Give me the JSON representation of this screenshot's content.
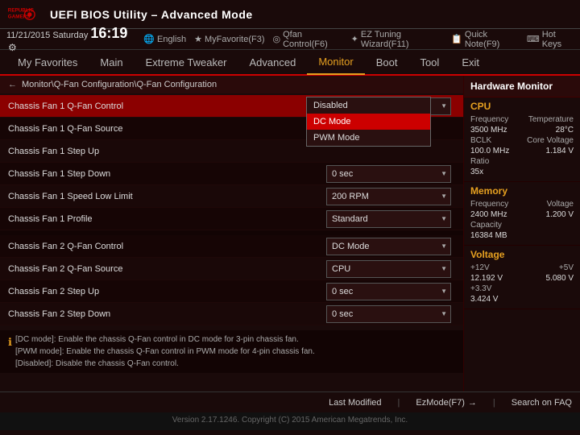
{
  "header": {
    "brand_line1": "REPUBLIC OF",
    "brand_line2": "GAMERS",
    "title": "UEFI BIOS Utility – Advanced Mode"
  },
  "toolbar": {
    "date": "11/21/2015",
    "day": "Saturday",
    "time": "16:19",
    "gear_icon": "⚙",
    "language": "English",
    "myfavorites": "MyFavorite(F3)",
    "qfan": "Qfan Control(F6)",
    "eztuning": "EZ Tuning Wizard(F11)",
    "quicknote": "Quick Note(F9)",
    "hotkeys": "Hot Keys"
  },
  "nav": {
    "items": [
      {
        "label": "My Favorites",
        "active": false
      },
      {
        "label": "Main",
        "active": false
      },
      {
        "label": "Extreme Tweaker",
        "active": false
      },
      {
        "label": "Advanced",
        "active": false
      },
      {
        "label": "Monitor",
        "active": true
      },
      {
        "label": "Boot",
        "active": false
      },
      {
        "label": "Tool",
        "active": false
      },
      {
        "label": "Exit",
        "active": false
      }
    ]
  },
  "breadcrumb": "Monitor\\Q-Fan Configuration\\Q-Fan Configuration",
  "settings": [
    {
      "label": "Chassis Fan 1 Q-Fan Control",
      "value": "DC Mode",
      "active": true,
      "type": "dropdown"
    },
    {
      "label": "Chassis Fan 1 Q-Fan Source",
      "value": "",
      "active": false,
      "type": "empty"
    },
    {
      "label": "Chassis Fan 1 Step Up",
      "value": "",
      "active": false,
      "type": "empty"
    },
    {
      "label": "Chassis Fan 1 Step Down",
      "value": "0 sec",
      "active": false,
      "type": "dropdown"
    },
    {
      "label": "Chassis Fan 1 Speed Low Limit",
      "value": "200 RPM",
      "active": false,
      "type": "dropdown"
    },
    {
      "label": "Chassis Fan 1 Profile",
      "value": "Standard",
      "active": false,
      "type": "dropdown"
    },
    {
      "label": "Chassis Fan 2 Q-Fan Control",
      "value": "DC Mode",
      "active": false,
      "type": "dropdown"
    },
    {
      "label": "Chassis Fan 2 Q-Fan Source",
      "value": "CPU",
      "active": false,
      "type": "dropdown"
    },
    {
      "label": "Chassis Fan 2 Step Up",
      "value": "0 sec",
      "active": false,
      "type": "dropdown"
    },
    {
      "label": "Chassis Fan 2 Step Down",
      "value": "0 sec",
      "active": false,
      "type": "dropdown"
    }
  ],
  "dropdown_popup": {
    "items": [
      {
        "label": "Disabled",
        "selected": false
      },
      {
        "label": "DC Mode",
        "selected": true
      },
      {
        "label": "PWM Mode",
        "selected": false
      }
    ]
  },
  "info_lines": [
    "[DC mode]: Enable the chassis Q-Fan control in DC mode for 3-pin chassis fan.",
    "[PWM mode]: Enable the chassis Q-Fan control in PWM mode for 4-pin chassis fan.",
    "[Disabled]: Disable the chassis Q-Fan control."
  ],
  "hw_monitor": {
    "title": "Hardware Monitor",
    "cpu": {
      "section_title": "CPU",
      "frequency_label": "Frequency",
      "frequency_value": "3500 MHz",
      "temperature_label": "Temperature",
      "temperature_value": "28°C",
      "bclk_label": "BCLK",
      "bclk_value": "100.0 MHz",
      "core_voltage_label": "Core Voltage",
      "core_voltage_value": "1.184 V",
      "ratio_label": "Ratio",
      "ratio_value": "35x"
    },
    "memory": {
      "section_title": "Memory",
      "frequency_label": "Frequency",
      "frequency_value": "2400 MHz",
      "voltage_label": "Voltage",
      "voltage_value": "1.200 V",
      "capacity_label": "Capacity",
      "capacity_value": "16384 MB"
    },
    "voltage": {
      "section_title": "Voltage",
      "v12_label": "+12V",
      "v12_value": "12.192 V",
      "v5_label": "+5V",
      "v5_value": "5.080 V",
      "v33_label": "+3.3V",
      "v33_value": "3.424 V"
    }
  },
  "status_bar": {
    "last_modified": "Last Modified",
    "ez_mode": "EzMode(F7)",
    "ez_icon": "→",
    "search": "Search on FAQ"
  },
  "footer": {
    "text": "Version 2.17.1246. Copyright (C) 2015 American Megatrends, Inc."
  }
}
